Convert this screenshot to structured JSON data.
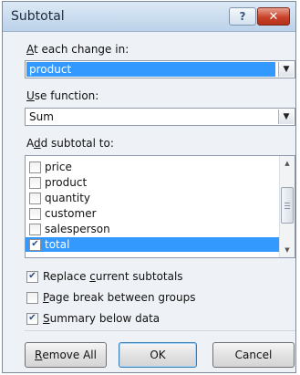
{
  "dialog": {
    "title": "Subtotal",
    "help_symbol": "?",
    "close_symbol": "✕"
  },
  "at_each_change": {
    "label_mnemonic": "A",
    "label_rest": "t each change in:",
    "value": "product"
  },
  "use_function": {
    "label_mnemonic": "U",
    "label_rest": "se function:",
    "value": "Sum"
  },
  "add_subtotal": {
    "label_pre": "A",
    "label_mnemonic": "d",
    "label_rest": "d subtotal to:",
    "items": [
      {
        "label": "price",
        "checked": false,
        "selected": false
      },
      {
        "label": "product",
        "checked": false,
        "selected": false
      },
      {
        "label": "quantity",
        "checked": false,
        "selected": false
      },
      {
        "label": "customer",
        "checked": false,
        "selected": false
      },
      {
        "label": "salesperson",
        "checked": false,
        "selected": false
      },
      {
        "label": "total",
        "checked": true,
        "selected": true
      }
    ]
  },
  "options": {
    "replace": {
      "pre": "Replace ",
      "mnemonic": "c",
      "rest": "urrent subtotals",
      "checked": true
    },
    "page_break": {
      "pre": "",
      "mnemonic": "P",
      "rest": "age break between groups",
      "checked": false
    },
    "summary": {
      "pre": "",
      "mnemonic": "S",
      "rest": "ummary below data",
      "checked": true
    }
  },
  "buttons": {
    "remove_all_mnemonic": "R",
    "remove_all_rest": "emove All",
    "ok": "OK",
    "cancel": "Cancel"
  },
  "icons": {
    "dropdown": "chevron-down-icon",
    "check": "checkmark-icon",
    "scroll_up": "scroll-up-icon",
    "scroll_down": "scroll-down-icon"
  },
  "colors": {
    "selection": "#3399ff",
    "close_button": "#c9432a"
  }
}
